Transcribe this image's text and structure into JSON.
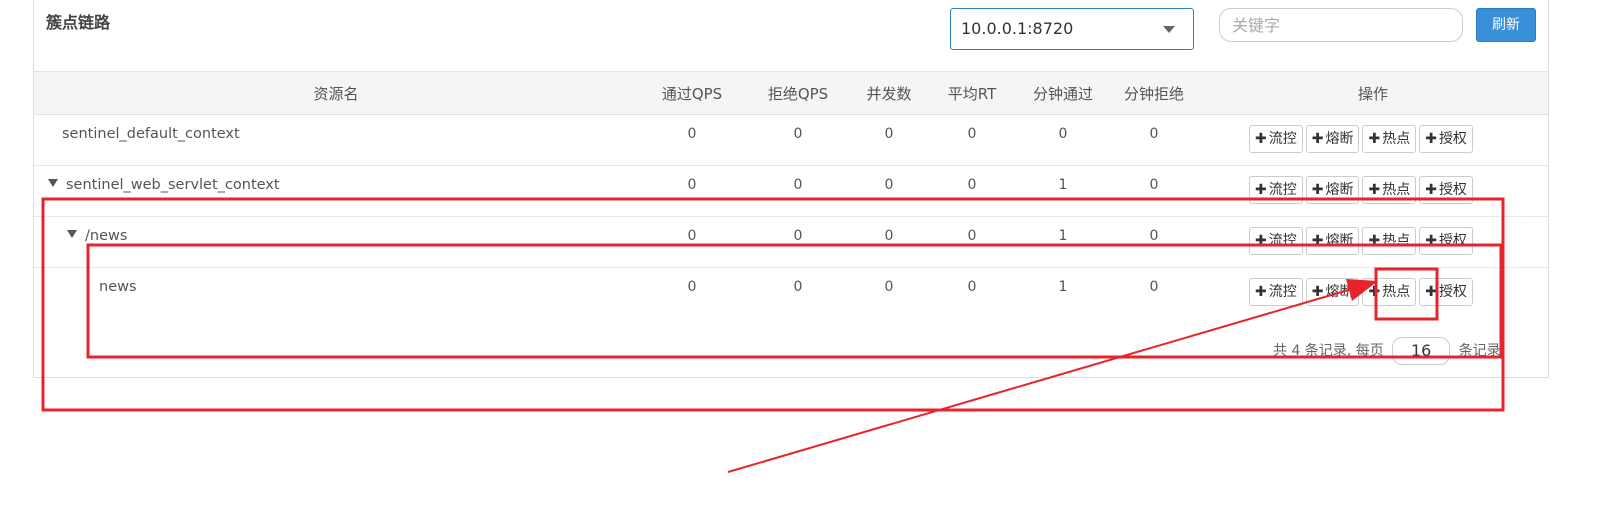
{
  "panel": {
    "title": "簇点链路",
    "machine_select": "10.0.0.1:8720",
    "search_placeholder": "关键字",
    "refresh_label": "刷新"
  },
  "table": {
    "headers": {
      "resource": "资源名",
      "pass_qps": "通过QPS",
      "block_qps": "拒绝QPS",
      "concurrency": "并发数",
      "avg_rt": "平均RT",
      "minute_pass": "分钟通过",
      "minute_block": "分钟拒绝",
      "ops": "操作"
    },
    "rows": [
      {
        "name": "sentinel_default_context",
        "pass_qps": "0",
        "block_qps": "0",
        "concurrency": "0",
        "avg_rt": "0",
        "minute_pass": "0",
        "minute_block": "0"
      },
      {
        "name": "sentinel_web_servlet_context",
        "pass_qps": "0",
        "block_qps": "0",
        "concurrency": "0",
        "avg_rt": "0",
        "minute_pass": "1",
        "minute_block": "0"
      },
      {
        "name": "/news",
        "pass_qps": "0",
        "block_qps": "0",
        "concurrency": "0",
        "avg_rt": "0",
        "minute_pass": "1",
        "minute_block": "0"
      },
      {
        "name": "news",
        "pass_qps": "0",
        "block_qps": "0",
        "concurrency": "0",
        "avg_rt": "0",
        "minute_pass": "1",
        "minute_block": "0"
      }
    ],
    "op_plus": "✚",
    "op_labels": {
      "flow": "流控",
      "degrade": "熔断",
      "hotspot": "热点",
      "authority": "授权"
    }
  },
  "pager": {
    "prefix": "共 4 条记录, 每页",
    "page_size": "16",
    "suffix": "条记录"
  },
  "colors": {
    "annotation": "#e8232b",
    "primary": "#3a8fd9"
  }
}
